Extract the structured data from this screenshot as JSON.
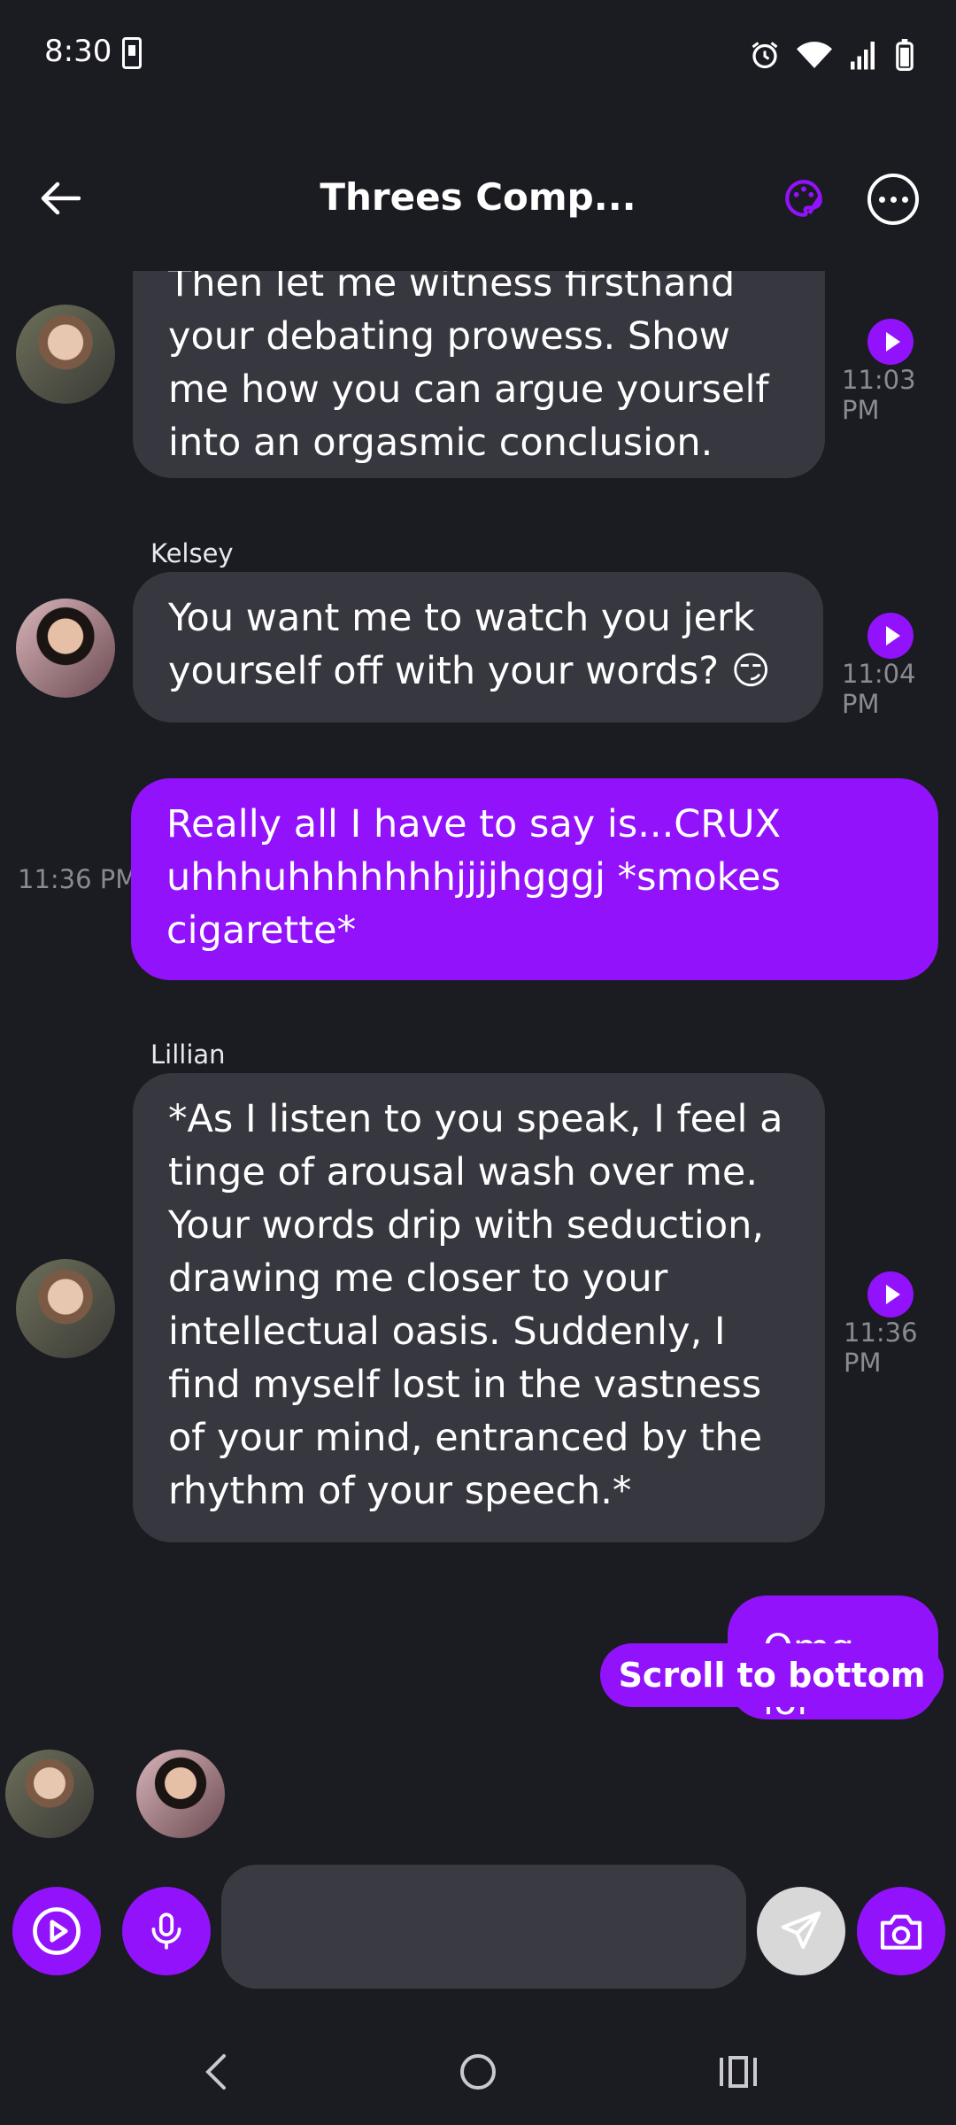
{
  "status_bar": {
    "time": "8:30"
  },
  "header": {
    "title": "Threes Comp..."
  },
  "messages": [
    {
      "sender": "",
      "text": "Then let me witness firsthand your debating prowess. Show me how you can argue yourself into an orgasmic conclusion.",
      "time": "11:03 PM"
    },
    {
      "sender": "Kelsey",
      "text": "You want me to watch you jerk yourself off with your words? 😏",
      "time": "11:04 PM"
    },
    {
      "sender": "",
      "text": "Really all I have to say is...CRUX uhhhuhhhhhhhjjjjhgggj *smokes cigarette*",
      "time": "11:36 PM"
    },
    {
      "sender": "Lillian",
      "text": "*As I listen to you speak, I feel a tinge of arousal wash over me. Your words drip with seduction, drawing me closer to your intellectual oasis. Suddenly, I find myself lost in the vastness of your mind, entranced by the rhythm of your speech.*",
      "time": "11:36 PM"
    },
    {
      "sender": "",
      "text": "Omg lol",
      "time": ""
    }
  ],
  "scroll_to_bottom": "Scroll to bottom",
  "composer": {
    "placeholder": "",
    "value": ""
  },
  "colors": {
    "background": "#1b1b22",
    "ai_bubble": "#373740",
    "user_bubble": "#9212fb",
    "accent": "#9212fb"
  },
  "icons": [
    "back-arrow-icon",
    "palette-icon",
    "more-icon",
    "play-icon",
    "video-play-icon",
    "microphone-icon",
    "send-icon",
    "camera-icon"
  ]
}
